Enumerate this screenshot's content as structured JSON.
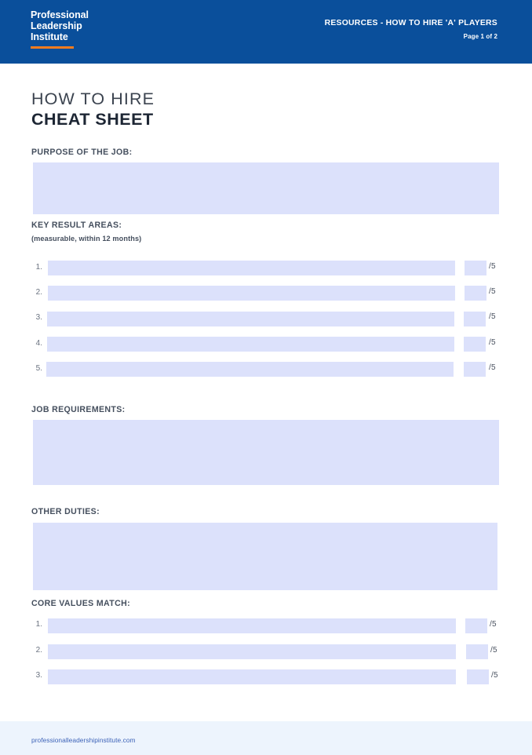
{
  "header": {
    "logo_lines": [
      "Professional",
      "Leadership",
      "Institute"
    ],
    "resource_title": "RESOURCES - HOW TO HIRE 'A' PLAYERS",
    "page_indicator": "Page 1 of 2",
    "bg_color": "#0a4f9b",
    "accent_color": "#f57c1f"
  },
  "document": {
    "title_light": "HOW TO HIRE",
    "title_bold": "CHEAT SHEET",
    "fill_color": "#dce1fb"
  },
  "sections": {
    "purpose": {
      "label": "PURPOSE OF THE JOB:"
    },
    "key_result_areas": {
      "label": "KEY RESULT AREAS:",
      "sublabel": "(measurable, within 12 months)",
      "rows": [
        {
          "number": "1.",
          "value": "",
          "score": "",
          "score_suffix": "/5"
        },
        {
          "number": "2.",
          "value": "",
          "score": "",
          "score_suffix": "/5"
        },
        {
          "number": "3.",
          "value": "",
          "score": "",
          "score_suffix": "/5"
        },
        {
          "number": "4.",
          "value": "",
          "score": "",
          "score_suffix": "/5"
        },
        {
          "number": "5.",
          "value": "",
          "score": "",
          "score_suffix": "/5"
        }
      ]
    },
    "job_requirements": {
      "label": "JOB REQUIREMENTS:"
    },
    "other_duties": {
      "label": "OTHER DUTIES:"
    },
    "core_values_match": {
      "label": "CORE VALUES MATCH:",
      "rows": [
        {
          "number": "1.",
          "value": "",
          "score": "",
          "score_suffix": "/5"
        },
        {
          "number": "2.",
          "value": "",
          "score": "",
          "score_suffix": "/5"
        },
        {
          "number": "3.",
          "value": "",
          "score": "",
          "score_suffix": "/5"
        }
      ]
    }
  },
  "footer": {
    "website": "professionalleadershipinstitute.com",
    "bg_color": "#edf4fd",
    "link_color": "#3d63b8"
  }
}
